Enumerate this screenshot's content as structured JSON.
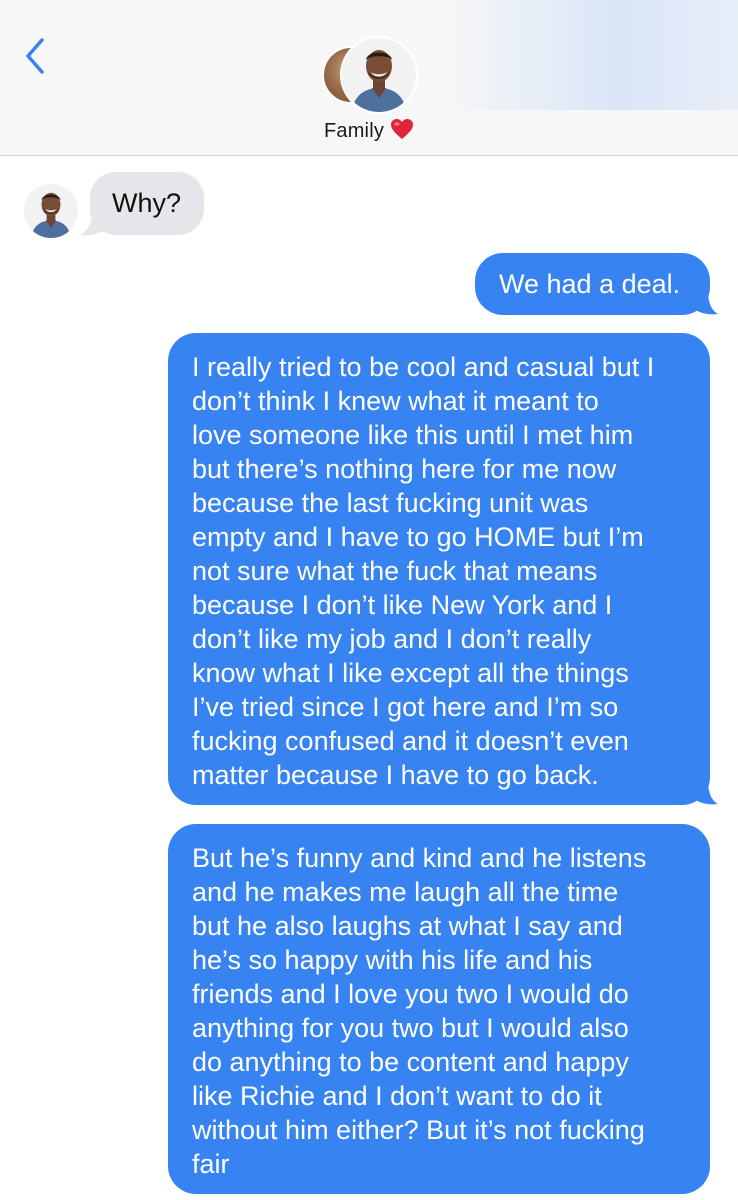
{
  "header": {
    "back_icon": "chevron-left-icon",
    "group_name": "Family",
    "group_emoji": "❤️",
    "accent_color": "#3683f1"
  },
  "messages": [
    {
      "direction": "received",
      "text": "Why?"
    },
    {
      "direction": "sent",
      "text": "We had a deal."
    },
    {
      "direction": "sent",
      "text": "I really tried to be cool and casual but I\ndon’t think I knew what it meant to\nlove someone like this until I met him\nbut there’s nothing here for me now\nbecause the last fucking unit was\nempty and I have to go HOME but I’m\nnot sure what the fuck that means\nbecause I don’t like New York and I\ndon’t like my job and I don’t really\nknow what I like except all the things\nI’ve tried since I got here and I’m so\nfucking confused and it doesn’t even\nmatter because I have to go back."
    },
    {
      "direction": "sent",
      "text": "But he’s funny and kind and he listens\nand he makes me laugh all the time\nbut he also laughs at what I say and\nhe’s so happy with his life and his\nfriends and I love you two I would do\nanything for you two but I would also\ndo anything to be content and happy\nlike Richie and I don’t want to do it\nwithout him either? But it’s not fucking\nfair"
    }
  ],
  "colors": {
    "sent_bubble": "#3683f1",
    "received_bubble": "#e5e5ea",
    "header_bg": "#f7f7f7"
  }
}
